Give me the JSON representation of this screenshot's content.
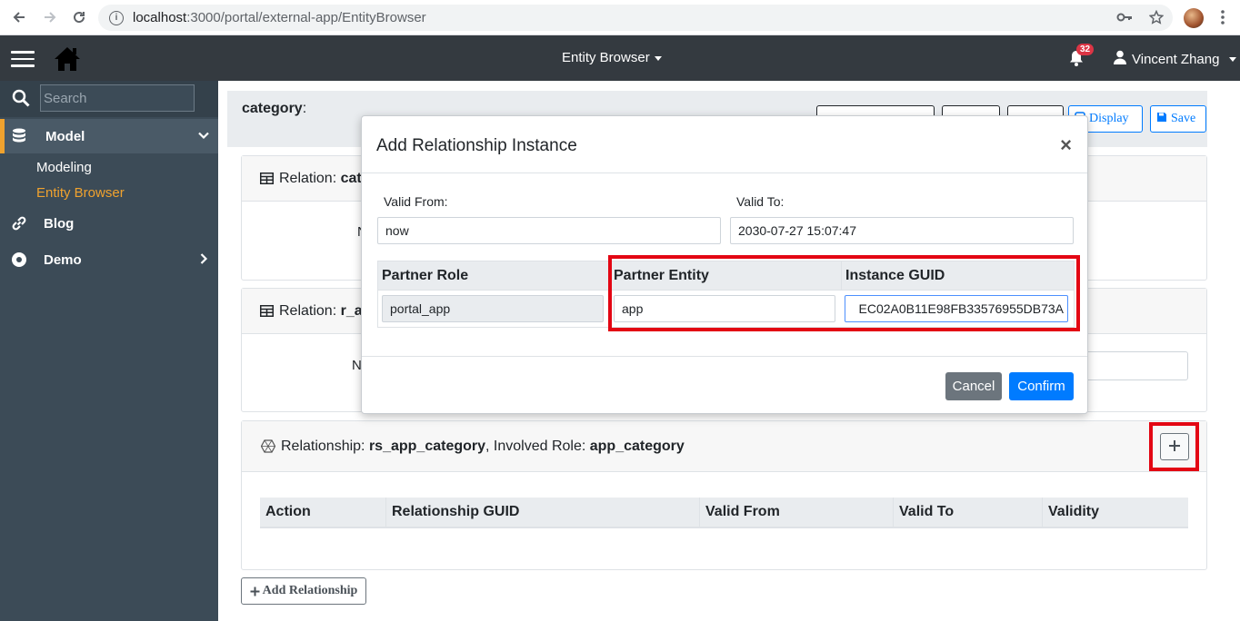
{
  "browser": {
    "url_host": "localhost",
    "url_rest": ":3000/portal/external-app/EntityBrowser"
  },
  "header": {
    "title": "Entity Browser",
    "notification_count": "32",
    "user_name": "Vincent Zhang"
  },
  "sidebar": {
    "search_placeholder": "Search",
    "items": [
      {
        "label": "Model",
        "icon": "database-icon"
      },
      {
        "label": "Blog",
        "icon": "link-icon"
      },
      {
        "label": "Demo",
        "icon": "record-icon"
      }
    ],
    "sub_items": [
      {
        "label": "Modeling"
      },
      {
        "label": "Entity Browser"
      }
    ]
  },
  "main": {
    "title_label": "category",
    "title_suffix": ":",
    "buttons": {
      "display": "Display",
      "save": "Save"
    },
    "relation1": {
      "prefix": "Relation: ",
      "name": "cat"
    },
    "relation2": {
      "prefix": "Relation: ",
      "name": "r_ap"
    },
    "frag_n1": "N",
    "frag_n2": "N",
    "relationship": {
      "prefix": "Relationship: ",
      "name": "rs_app_category",
      "role_prefix": ", Involved Role: ",
      "role": "app_category"
    },
    "grid_columns": [
      "Action",
      "Relationship GUID",
      "Valid From",
      "Valid To",
      "Validity"
    ],
    "add_relationship": "Add Relationship"
  },
  "modal": {
    "title": "Add Relationship Instance",
    "close": "×",
    "valid_from_label": "Valid From:",
    "valid_from_value": "now",
    "valid_to_label": "Valid To:",
    "valid_to_value": "2030-07-27 15:07:47",
    "columns": [
      "Partner Role",
      "Partner Entity",
      "Instance GUID"
    ],
    "partner_role": "portal_app",
    "partner_entity": "app",
    "instance_guid": "EC02A0B11E98FB33576955DB73A",
    "cancel": "Cancel",
    "confirm": "Confirm"
  },
  "colors": {
    "sidebar": "#3c4b57",
    "header": "#343a40",
    "accent": "#f0a22e",
    "primary": "#007bff",
    "highlight": "#e30613"
  }
}
